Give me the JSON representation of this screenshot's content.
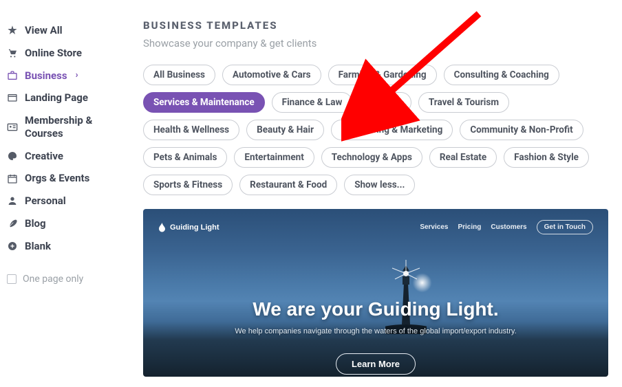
{
  "sidebar": {
    "items": [
      {
        "label": "View All"
      },
      {
        "label": "Online Store"
      },
      {
        "label": "Business",
        "active": true,
        "chevron": true
      },
      {
        "label": "Landing Page"
      },
      {
        "label": "Membership & Courses"
      },
      {
        "label": "Creative"
      },
      {
        "label": "Orgs & Events"
      },
      {
        "label": "Personal"
      },
      {
        "label": "Blog"
      },
      {
        "label": "Blank"
      }
    ],
    "one_page_label": "One page only"
  },
  "main": {
    "title": "BUSINESS TEMPLATES",
    "subtitle": "Showcase your company & get clients"
  },
  "filters": [
    "All Business",
    "Automotive & Cars",
    "Farming & Gardening",
    "Consulting & Coaching",
    "Services & Maintenance",
    "Finance & Law",
    "Agency",
    "Travel & Tourism",
    "Health & Wellness",
    "Beauty & Hair",
    "Advertising & Marketing",
    "Community & Non-Profit",
    "Pets & Animals",
    "Entertainment",
    "Technology & Apps",
    "Real Estate",
    "Fashion & Style",
    "Sports & Fitness",
    "Restaurant & Food",
    "Show less..."
  ],
  "filters_active_index": 4,
  "preview": {
    "brand": "Guiding Light",
    "nav": {
      "services": "Services",
      "pricing": "Pricing",
      "customers": "Customers",
      "contact": "Get in Touch"
    },
    "hero": {
      "headline": "We are your Guiding Light.",
      "sub": "We help companies navigate through the waters of the global import/export industry.",
      "cta": "Learn More"
    }
  }
}
